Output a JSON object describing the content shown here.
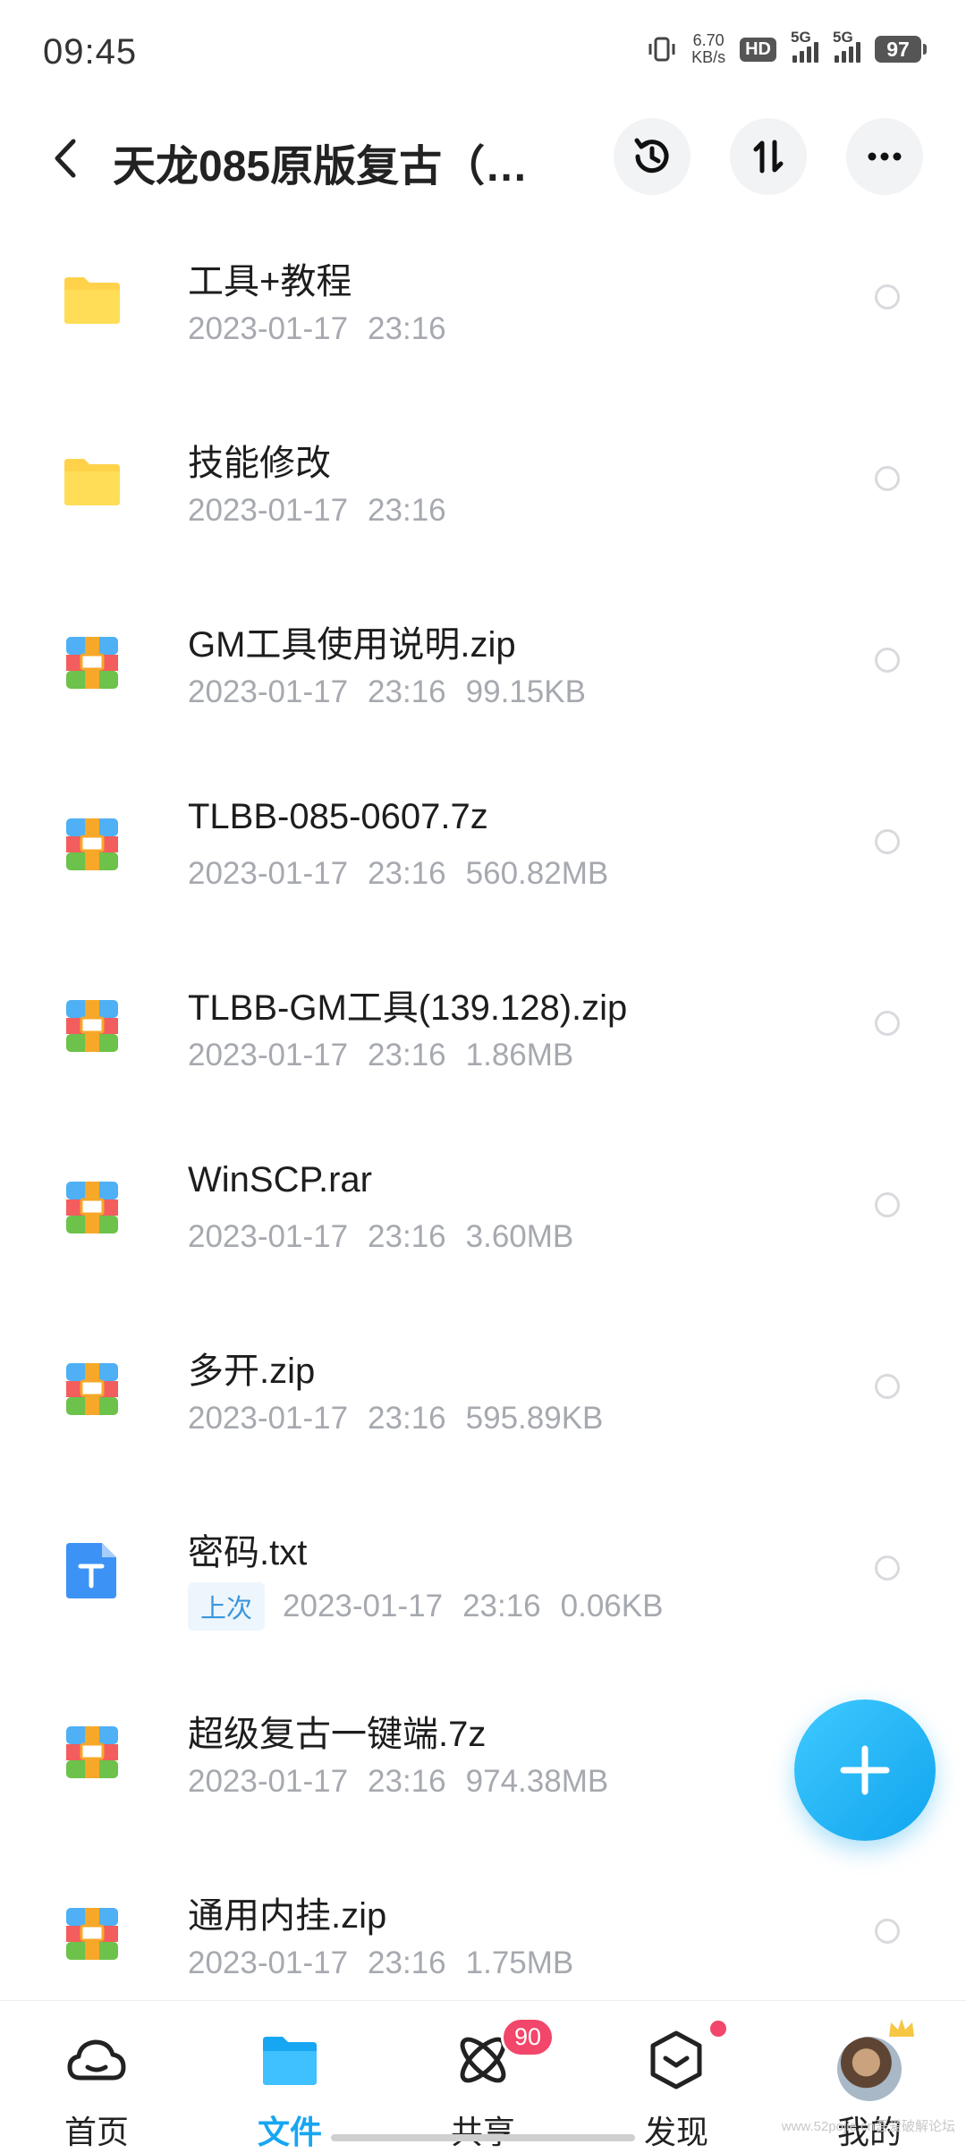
{
  "status_bar": {
    "time": "09:45",
    "net_speed_value": "6.70",
    "net_speed_unit": "KB/s",
    "hd_label": "HD",
    "signal1_label": "5G",
    "signal2_label": "5G",
    "battery": "97"
  },
  "header": {
    "title": "天龙085原版复古（…",
    "icons": [
      "back-icon",
      "history-icon",
      "sort-icon",
      "more-icon"
    ]
  },
  "files": [
    {
      "name": "工具+教程",
      "date": "2023-01-17",
      "time": "23:16",
      "size": "",
      "tag": "",
      "type": "folder"
    },
    {
      "name": "技能修改",
      "date": "2023-01-17",
      "time": "23:16",
      "size": "",
      "tag": "",
      "type": "folder"
    },
    {
      "name": "GM工具使用说明.zip",
      "date": "2023-01-17",
      "time": "23:16",
      "size": "99.15KB",
      "tag": "",
      "type": "archive"
    },
    {
      "name": "TLBB-085-0607.7z",
      "date": "2023-01-17",
      "time": "23:16",
      "size": "560.82MB",
      "tag": "",
      "type": "archive"
    },
    {
      "name": "TLBB-GM工具(139.128).zip",
      "date": "2023-01-17",
      "time": "23:16",
      "size": "1.86MB",
      "tag": "",
      "type": "archive"
    },
    {
      "name": "WinSCP.rar",
      "date": "2023-01-17",
      "time": "23:16",
      "size": "3.60MB",
      "tag": "",
      "type": "archive"
    },
    {
      "name": "多开.zip",
      "date": "2023-01-17",
      "time": "23:16",
      "size": "595.89KB",
      "tag": "",
      "type": "archive"
    },
    {
      "name": "密码.txt",
      "date": "2023-01-17",
      "time": "23:16",
      "size": "0.06KB",
      "tag": "上次",
      "type": "text"
    },
    {
      "name": "超级复古一键端.7z",
      "date": "2023-01-17",
      "time": "23:16",
      "size": "974.38MB",
      "tag": "",
      "type": "archive"
    },
    {
      "name": "通用内挂.zip",
      "date": "2023-01-17",
      "time": "23:16",
      "size": "1.75MB",
      "tag": "",
      "type": "archive"
    }
  ],
  "fab_icon": "plus-icon",
  "bottom_nav": {
    "items": [
      {
        "label": "首页",
        "icon": "cloud-home-icon"
      },
      {
        "label": "文件",
        "icon": "folder-icon"
      },
      {
        "label": "共享",
        "icon": "share-atom-icon",
        "badge": "90"
      },
      {
        "label": "发现",
        "icon": "discover-box-icon"
      },
      {
        "label": "我的",
        "icon": "avatar"
      }
    ],
    "active_index": 1
  },
  "watermark": "www.52pojie.cn吾爱破解论坛",
  "colors": {
    "accent": "#17a6f2",
    "folder": "#ffd24a",
    "badge": "#f2466a",
    "meta_text": "#a6a9af"
  }
}
